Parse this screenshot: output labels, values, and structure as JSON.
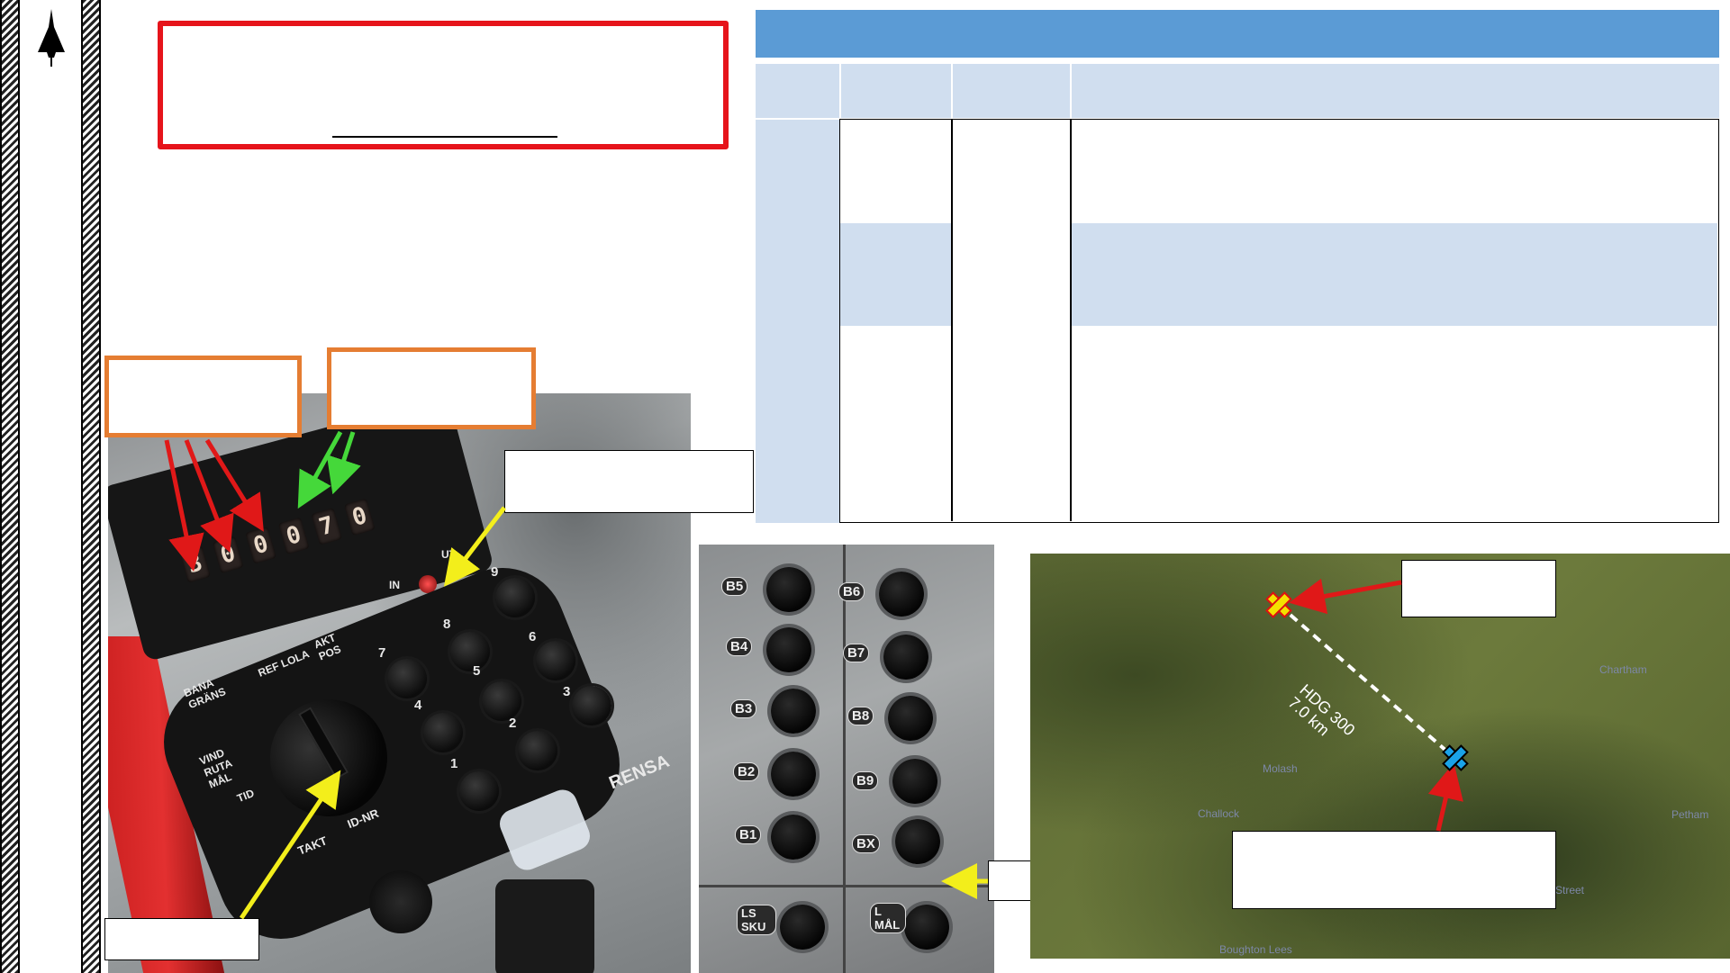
{
  "keypad_panel": {
    "display_digits": [
      "3",
      "0",
      "0",
      "0",
      "7",
      "0"
    ],
    "indicator_in": "IN",
    "indicator_ut": "UT",
    "keys": [
      "1",
      "2",
      "3",
      "4",
      "5",
      "6",
      "7",
      "8",
      "9"
    ],
    "mode_labels": [
      "BANA GRÄNS",
      "REF LOLA",
      "AKT POS",
      "VIND RUTA MÅL",
      "TID",
      "TAKT",
      "ID-NR"
    ],
    "rensa": "RENSA"
  },
  "button_panel": {
    "left_column": [
      "B5",
      "B4",
      "B3",
      "B2",
      "B1",
      "LS SKU"
    ],
    "right_column": [
      "B6",
      "B7",
      "B8",
      "B9",
      "BX",
      "L MÅL"
    ]
  },
  "map": {
    "heading_label": "HDG 300",
    "distance_label": "7.0 km",
    "places": [
      "Chartham",
      "Molash",
      "Challock",
      "Petham",
      "Street",
      "Boughton Lees"
    ],
    "colors": {
      "target_marker": "#f5e100",
      "origin_marker": "#1aa3e8",
      "arrow": "#e01818",
      "route": "#ffffff"
    }
  },
  "colors": {
    "header_blue": "#5b9bd5",
    "light_blue": "#d0deef",
    "red_box": "#e6141b",
    "orange_box": "#e57d32",
    "red_arrow": "#e01818",
    "green_arrow": "#45d83a",
    "yellow_arrow": "#f3ee1b"
  }
}
